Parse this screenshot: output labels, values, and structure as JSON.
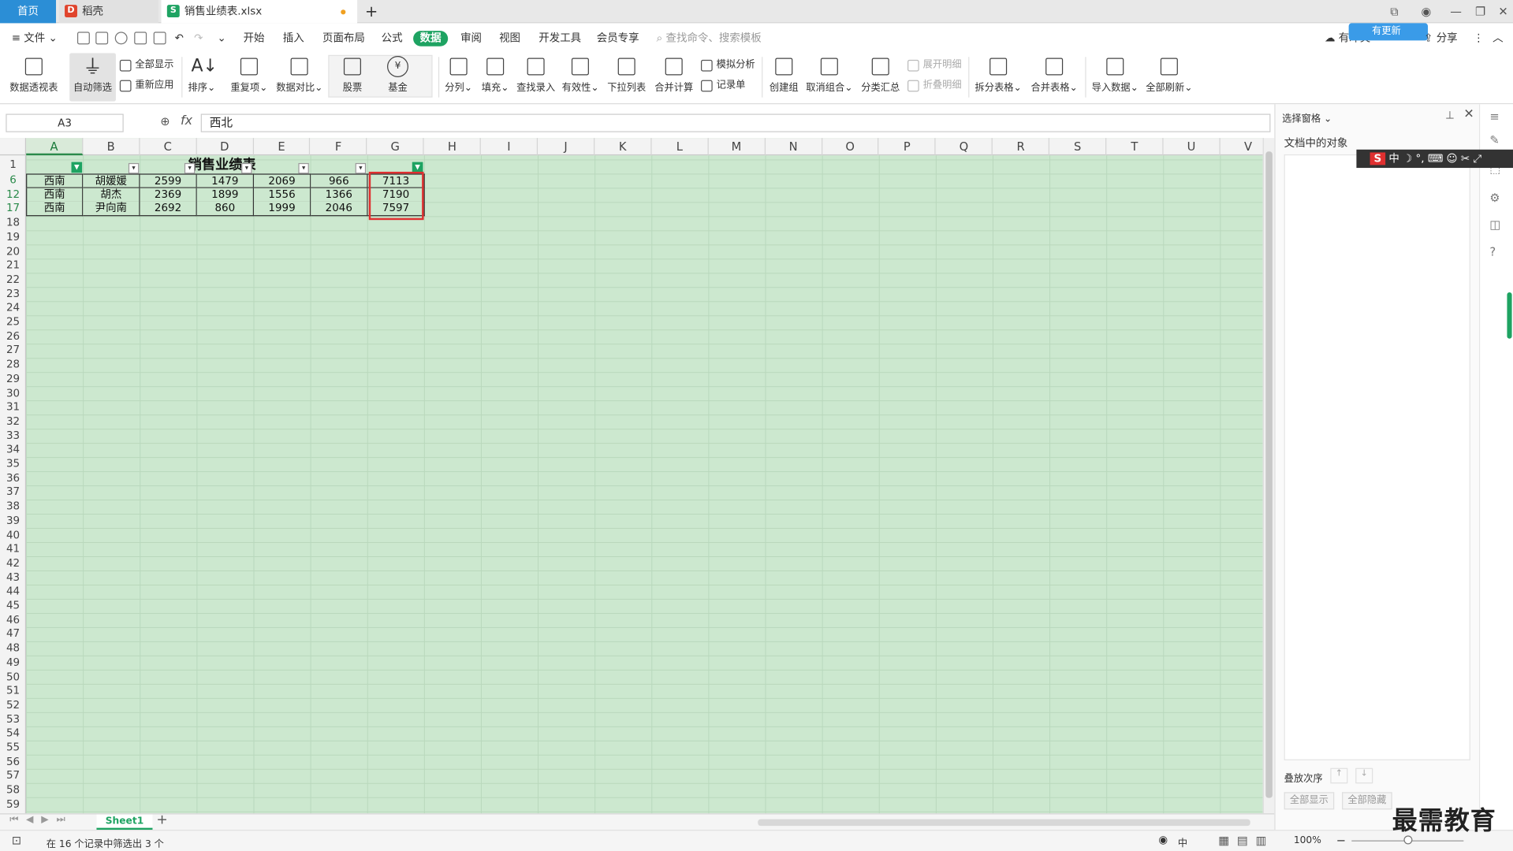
{
  "tabs": {
    "home": "首页",
    "daoke": "稻壳",
    "file": "销售业绩表.xlsx"
  },
  "menu": {
    "file": "文件",
    "items": [
      "开始",
      "插入",
      "页面布局",
      "公式",
      "数据",
      "审阅",
      "视图",
      "开发工具",
      "会员专享"
    ],
    "active_index": 4,
    "search": "查找命令、搜索模板",
    "user": "有冲突",
    "share": "分享",
    "badge": "有更新"
  },
  "ribbon": {
    "pivot": "数据透视表",
    "autofilter": "自动筛选",
    "show_all": "全部显示",
    "reapply": "重新应用",
    "sort": "排序",
    "dup": "重复项",
    "compare": "数据对比",
    "stock": "股票",
    "fund": "基金",
    "split": "分列",
    "fill": "填充",
    "lookup": "查找录入",
    "validity": "有效性",
    "dropdown": "下拉列表",
    "consolidate": "合并计算",
    "whatif": "模拟分析",
    "record": "记录单",
    "group": "创建组",
    "ungroup": "取消组合",
    "subtotal": "分类汇总",
    "expand": "展开明细",
    "collapse": "折叠明细",
    "split_table": "拆分表格",
    "merge_table": "合并表格",
    "import": "导入数据",
    "refresh": "全部刷新"
  },
  "formula": {
    "cell": "A3",
    "value": "西北"
  },
  "columns": [
    "A",
    "B",
    "C",
    "D",
    "E",
    "F",
    "G",
    "H",
    "I",
    "J",
    "K",
    "L",
    "M",
    "N",
    "O",
    "P",
    "Q",
    "R",
    "S",
    "T",
    "U",
    "V"
  ],
  "rows": [
    "1",
    "6",
    "12",
    "17",
    "18",
    "19",
    "20",
    "21",
    "22",
    "23",
    "24",
    "25",
    "26",
    "27",
    "28",
    "29",
    "30",
    "31",
    "32",
    "33",
    "34",
    "35",
    "36",
    "37",
    "38",
    "39",
    "40",
    "41",
    "42",
    "43",
    "44",
    "45",
    "46",
    "47",
    "48",
    "49",
    "50",
    "51",
    "52",
    "53",
    "54",
    "55",
    "56",
    "57",
    "58",
    "59"
  ],
  "sheet_title": "销售业绩表",
  "data_rows": [
    [
      "西南",
      "胡媛媛",
      "2599",
      "1479",
      "2069",
      "966",
      "7113"
    ],
    [
      "西南",
      "胡杰",
      "2369",
      "1899",
      "1556",
      "1366",
      "7190"
    ],
    [
      "西南",
      "尹向南",
      "2692",
      "860",
      "1999",
      "2046",
      "7597"
    ]
  ],
  "sheet_tab": "Sheet1",
  "status": "在 16 个记录中筛选出 3 个",
  "zoom": "100%",
  "ime": "中",
  "panel": {
    "title": "选择窗格",
    "objects": "文档中的对象",
    "order": "叠放次序",
    "show_all": "全部显示",
    "hide_all": "全部隐藏"
  },
  "watermark": "最需教育"
}
